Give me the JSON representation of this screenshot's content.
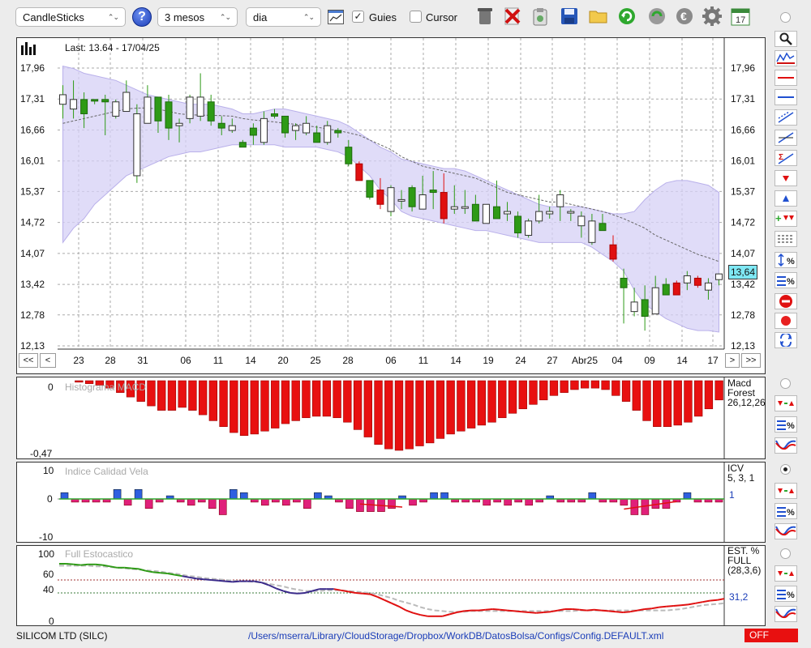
{
  "toolbar": {
    "chart_type": "CandleSticks",
    "period": "3 mesos",
    "interval": "dia",
    "guides_label": "Guies",
    "guides_checked": true,
    "cursor_label": "Cursor",
    "cursor_checked": false,
    "calendar_day": "17"
  },
  "main": {
    "last_label": "Last: 13.64 - 17/04/25",
    "price_badge": "13,64",
    "y_ticks": [
      "17,96",
      "17,31",
      "16,66",
      "16,01",
      "15,37",
      "14,72",
      "14,07",
      "13,42",
      "12,78",
      "12,13"
    ],
    "x_ticks": [
      "23",
      "28",
      "31",
      "06",
      "11",
      "14",
      "20",
      "25",
      "28",
      "06",
      "11",
      "14",
      "19",
      "24",
      "27",
      "Abr25",
      "04",
      "09",
      "14",
      "17"
    ],
    "nav": {
      "first": "<<",
      "prev": "<",
      "next": ">",
      "last": ">>"
    }
  },
  "macd": {
    "title": "Histograma MACD",
    "label_line1": "Macd",
    "label_line2": "Forest",
    "label_line3": "26,12,26",
    "y_top": "0",
    "y_bottom": "-0,47"
  },
  "icv": {
    "title": "Indice Calidad Vela",
    "label_line1": "ICV",
    "label_line2": "5, 3, 1",
    "value": "1",
    "y_top": "10",
    "y_mid": "0",
    "y_bottom": "-10"
  },
  "stoch": {
    "title": "Full Estocastico",
    "label_line1": "EST. %",
    "label_line2": "FULL",
    "label_line3": "(28,3,6)",
    "value": "31,2",
    "y_ticks": [
      "100",
      "60",
      "40",
      "0"
    ]
  },
  "status": {
    "symbol": "SILICOM LTD (SILC)",
    "path": "/Users/mserra/Library/CloudStorage/Dropbox/WorkDB/DatosBolsa/Configs/Config.DEFAULT.xml",
    "off_label": "OFF"
  },
  "colors": {
    "up": "#2e9a16",
    "down": "#e01010",
    "band": "#d6d0f5",
    "badge": "#7fe8f4",
    "macd": "#e81010",
    "icv_pos": "#2f5fe0",
    "icv_neg": "#e0207a"
  },
  "chart_data": [
    {
      "type": "candlestick",
      "title": "",
      "ylim": [
        12.13,
        18.3
      ],
      "candles": [
        {
          "o": 17.2,
          "h": 17.6,
          "l": 16.9,
          "c": 17.4
        },
        {
          "o": 17.1,
          "h": 17.7,
          "l": 16.9,
          "c": 17.3
        },
        {
          "o": 17.3,
          "h": 17.45,
          "l": 16.7,
          "c": 17.0
        },
        {
          "o": 17.3,
          "h": 17.3,
          "l": 17.2,
          "c": 17.28
        },
        {
          "o": 17.3,
          "h": 17.4,
          "l": 16.55,
          "c": 17.25
        },
        {
          "o": 16.95,
          "h": 17.3,
          "l": 16.9,
          "c": 17.25
        },
        {
          "o": 17.05,
          "h": 17.7,
          "l": 17.05,
          "c": 17.45
        },
        {
          "o": 15.7,
          "h": 17.2,
          "l": 15.55,
          "c": 17.0
        },
        {
          "o": 16.8,
          "h": 17.6,
          "l": 16.8,
          "c": 17.35
        },
        {
          "o": 17.35,
          "h": 17.35,
          "l": 16.6,
          "c": 16.85
        },
        {
          "o": 17.25,
          "h": 17.4,
          "l": 16.45,
          "c": 16.7
        },
        {
          "o": 16.75,
          "h": 16.9,
          "l": 16.4,
          "c": 16.8
        },
        {
          "o": 16.9,
          "h": 17.4,
          "l": 16.8,
          "c": 17.35
        },
        {
          "o": 16.95,
          "h": 17.85,
          "l": 16.85,
          "c": 17.35
        },
        {
          "o": 17.25,
          "h": 17.4,
          "l": 16.75,
          "c": 16.85
        },
        {
          "o": 16.8,
          "h": 16.95,
          "l": 16.55,
          "c": 16.7
        },
        {
          "o": 16.65,
          "h": 16.9,
          "l": 16.6,
          "c": 16.75
        },
        {
          "o": 16.4,
          "h": 16.45,
          "l": 16.3,
          "c": 16.3
        },
        {
          "o": 16.7,
          "h": 16.8,
          "l": 16.35,
          "c": 16.55
        },
        {
          "o": 16.4,
          "h": 17.05,
          "l": 16.35,
          "c": 16.9
        },
        {
          "o": 17.0,
          "h": 17.1,
          "l": 16.9,
          "c": 16.95
        },
        {
          "o": 16.95,
          "h": 16.95,
          "l": 16.5,
          "c": 16.6
        },
        {
          "o": 16.65,
          "h": 16.8,
          "l": 16.45,
          "c": 16.75
        },
        {
          "o": 16.6,
          "h": 16.95,
          "l": 16.55,
          "c": 16.8
        },
        {
          "o": 16.6,
          "h": 16.75,
          "l": 16.4,
          "c": 16.4
        },
        {
          "o": 16.4,
          "h": 16.85,
          "l": 16.35,
          "c": 16.75
        },
        {
          "o": 16.65,
          "h": 16.7,
          "l": 16.5,
          "c": 16.6
        },
        {
          "o": 16.3,
          "h": 16.45,
          "l": 15.9,
          "c": 15.95
        },
        {
          "o": 15.95,
          "h": 16.0,
          "l": 15.6,
          "c": 15.6
        },
        {
          "o": 15.6,
          "h": 15.6,
          "l": 15.2,
          "c": 15.25
        },
        {
          "o": 15.4,
          "h": 15.65,
          "l": 15.0,
          "c": 15.1
        },
        {
          "o": 14.95,
          "h": 15.5,
          "l": 14.85,
          "c": 15.45
        },
        {
          "o": 15.2,
          "h": 15.4,
          "l": 15.0,
          "c": 15.2
        },
        {
          "o": 15.45,
          "h": 15.5,
          "l": 14.95,
          "c": 15.05
        },
        {
          "o": 15.0,
          "h": 15.7,
          "l": 15.0,
          "c": 15.3
        },
        {
          "o": 15.4,
          "h": 15.8,
          "l": 15.0,
          "c": 15.35
        },
        {
          "o": 15.35,
          "h": 15.75,
          "l": 14.7,
          "c": 14.8
        },
        {
          "o": 15.0,
          "h": 15.5,
          "l": 14.9,
          "c": 15.05
        },
        {
          "o": 15.05,
          "h": 15.4,
          "l": 14.9,
          "c": 15.05
        },
        {
          "o": 15.1,
          "h": 15.3,
          "l": 14.75,
          "c": 14.75
        },
        {
          "o": 14.7,
          "h": 15.0,
          "l": 14.7,
          "c": 15.1
        },
        {
          "o": 15.05,
          "h": 15.6,
          "l": 14.85,
          "c": 14.8
        },
        {
          "o": 14.9,
          "h": 15.15,
          "l": 14.75,
          "c": 14.95
        },
        {
          "o": 14.85,
          "h": 14.95,
          "l": 14.4,
          "c": 14.5
        },
        {
          "o": 14.45,
          "h": 14.8,
          "l": 14.4,
          "c": 14.75
        },
        {
          "o": 14.75,
          "h": 15.3,
          "l": 14.7,
          "c": 14.95
        },
        {
          "o": 14.9,
          "h": 15.05,
          "l": 14.8,
          "c": 14.95
        },
        {
          "o": 15.05,
          "h": 15.4,
          "l": 14.75,
          "c": 15.3
        },
        {
          "o": 14.95,
          "h": 15.0,
          "l": 14.75,
          "c": 14.95
        },
        {
          "o": 14.65,
          "h": 14.95,
          "l": 14.4,
          "c": 14.85
        },
        {
          "o": 14.3,
          "h": 14.9,
          "l": 14.25,
          "c": 14.75
        },
        {
          "o": 14.7,
          "h": 14.9,
          "l": 14.6,
          "c": 14.55
        },
        {
          "o": 14.25,
          "h": 14.45,
          "l": 13.9,
          "c": 13.95
        },
        {
          "o": 13.55,
          "h": 13.75,
          "l": 12.6,
          "c": 13.35
        },
        {
          "o": 12.85,
          "h": 13.35,
          "l": 12.75,
          "c": 13.05
        },
        {
          "o": 13.1,
          "h": 13.4,
          "l": 12.45,
          "c": 12.75
        },
        {
          "o": 12.8,
          "h": 13.6,
          "l": 12.8,
          "c": 13.35
        },
        {
          "o": 13.42,
          "h": 13.55,
          "l": 13.2,
          "c": 13.2
        },
        {
          "o": 13.45,
          "h": 13.5,
          "l": 13.2,
          "c": 13.2
        },
        {
          "o": 13.45,
          "h": 13.7,
          "l": 13.3,
          "c": 13.6
        },
        {
          "o": 13.55,
          "h": 13.6,
          "l": 13.35,
          "c": 13.4
        },
        {
          "o": 13.3,
          "h": 13.55,
          "l": 13.1,
          "c": 13.45
        },
        {
          "o": 13.52,
          "h": 13.65,
          "l": 13.4,
          "c": 13.64
        }
      ],
      "band_upper": [
        18.0,
        17.95,
        17.85,
        17.8,
        17.75,
        17.7,
        17.6,
        17.5,
        17.4,
        17.35,
        17.3,
        17.25,
        17.2,
        17.2,
        17.2,
        17.15,
        17.1,
        17.0,
        17.0,
        17.05,
        17.1,
        17.1,
        17.05,
        17.0,
        16.95,
        16.9,
        16.85,
        16.75,
        16.6,
        16.45,
        16.3,
        16.2,
        16.05,
        16.0,
        15.95,
        15.9,
        15.85,
        15.85,
        15.8,
        15.7,
        15.6,
        15.5,
        15.4,
        15.3,
        15.2,
        15.1,
        15.05,
        15.05,
        15.05,
        15.05,
        15.0,
        14.95,
        14.9,
        14.9,
        14.95,
        15.2,
        15.4,
        15.55,
        15.6,
        15.6,
        15.55,
        15.5,
        15.35
      ],
      "band_lower": [
        14.3,
        14.6,
        14.8,
        15.1,
        15.3,
        15.5,
        15.7,
        15.8,
        15.9,
        16.0,
        16.1,
        16.15,
        16.2,
        16.2,
        16.25,
        16.3,
        16.35,
        16.35,
        16.35,
        16.35,
        16.35,
        16.3,
        16.3,
        16.3,
        16.3,
        16.25,
        16.2,
        16.1,
        15.9,
        15.7,
        15.4,
        15.2,
        14.95,
        14.85,
        14.8,
        14.75,
        14.7,
        14.65,
        14.6,
        14.55,
        14.55,
        14.5,
        14.45,
        14.4,
        14.35,
        14.3,
        14.3,
        14.3,
        14.3,
        14.3,
        14.2,
        14.05,
        13.9,
        13.7,
        13.3,
        13.0,
        12.85,
        12.7,
        12.6,
        12.5,
        12.45,
        12.45,
        12.42
      ],
      "ma": [
        16.8,
        16.85,
        16.9,
        16.95,
        17.0,
        17.05,
        17.1,
        17.12,
        17.12,
        17.1,
        17.05,
        17.0,
        16.98,
        16.97,
        16.97,
        16.96,
        16.95,
        16.9,
        16.87,
        16.85,
        16.83,
        16.8,
        16.78,
        16.75,
        16.72,
        16.68,
        16.65,
        16.6,
        16.55,
        16.45,
        16.35,
        16.25,
        16.1,
        16.0,
        15.9,
        15.85,
        15.8,
        15.75,
        15.7,
        15.65,
        15.55,
        15.45,
        15.35,
        15.3,
        15.25,
        15.2,
        15.15,
        15.15,
        15.1,
        15.05,
        15.0,
        14.95,
        14.88,
        14.8,
        14.7,
        14.6,
        14.45,
        14.35,
        14.25,
        14.15,
        14.05,
        13.98,
        13.9
      ]
    },
    {
      "type": "bar",
      "title": "Histograma MACD",
      "ylim": [
        -0.47,
        0
      ],
      "values": [
        -0.01,
        -0.02,
        -0.03,
        -0.05,
        -0.08,
        -0.11,
        -0.14,
        -0.17,
        -0.2,
        -0.2,
        -0.18,
        -0.2,
        -0.23,
        -0.27,
        -0.31,
        -0.35,
        -0.37,
        -0.36,
        -0.34,
        -0.32,
        -0.29,
        -0.27,
        -0.25,
        -0.24,
        -0.24,
        -0.25,
        -0.28,
        -0.33,
        -0.38,
        -0.43,
        -0.46,
        -0.47,
        -0.46,
        -0.44,
        -0.42,
        -0.39,
        -0.36,
        -0.34,
        -0.32,
        -0.3,
        -0.28,
        -0.25,
        -0.22,
        -0.19,
        -0.16,
        -0.13,
        -0.1,
        -0.08,
        -0.06,
        -0.05,
        -0.05,
        -0.06,
        -0.1,
        -0.14,
        -0.2,
        -0.27,
        -0.31,
        -0.31,
        -0.3,
        -0.28,
        -0.24,
        -0.19,
        -0.13
      ]
    },
    {
      "type": "bar",
      "title": "Indice Calidad Vela",
      "ylim": [
        -10,
        10
      ],
      "values": [
        2,
        -1,
        -1,
        -1,
        -1,
        3,
        -2,
        3,
        -3,
        -1,
        1,
        -1,
        -2,
        -1,
        -3,
        -5,
        3,
        2,
        -1,
        -2,
        -1,
        -2,
        -1,
        -3,
        2,
        1,
        -1,
        -3,
        -4,
        -4,
        -4,
        -3,
        1,
        -2,
        -1,
        2,
        2,
        -1,
        -1,
        -1,
        -2,
        -1,
        -2,
        -1,
        -2,
        -1,
        1,
        -1,
        -1,
        -1,
        2,
        -1,
        -1,
        -2,
        -5,
        -5,
        -3,
        -3,
        -1,
        2,
        -1,
        -1,
        -1
      ]
    },
    {
      "type": "line",
      "title": "Full Estocastico",
      "ylim": [
        0,
        100
      ],
      "series": [
        {
          "values": [
            85,
            85,
            84,
            83,
            84,
            84,
            83,
            81,
            79,
            79,
            78,
            77,
            74,
            72,
            71,
            70,
            68,
            66,
            64,
            62,
            61,
            60,
            59,
            58,
            57,
            58,
            58,
            58,
            56,
            52,
            47,
            43,
            40,
            39,
            40,
            43,
            46,
            46,
            46,
            44,
            42,
            40,
            39,
            38,
            34,
            29,
            24,
            19,
            13,
            9,
            6,
            4,
            4,
            4,
            7,
            10,
            12,
            13,
            13,
            14,
            15,
            14,
            13,
            12,
            11,
            10,
            9,
            10,
            11,
            13,
            15,
            15,
            14,
            13,
            14,
            13,
            12,
            11,
            10,
            11,
            13,
            15,
            16,
            18,
            19,
            20,
            21,
            22,
            24,
            26,
            28,
            29,
            31
          ]
        },
        {
          "values": [
            82,
            82,
            82,
            82,
            82,
            81,
            81,
            80,
            79,
            78,
            77,
            76,
            75,
            74,
            73,
            71,
            70,
            68,
            66,
            65,
            63,
            62,
            61,
            60,
            59,
            58,
            58,
            57,
            56,
            54,
            52,
            50,
            47,
            45,
            43,
            43,
            43,
            44,
            44,
            44,
            43,
            42,
            41,
            40,
            38,
            35,
            32,
            28,
            25,
            22,
            18,
            15,
            13,
            12,
            11,
            11,
            11,
            12,
            12,
            12,
            12,
            12,
            12,
            12,
            12,
            12,
            12,
            12,
            12,
            12,
            12,
            12,
            13,
            13,
            13,
            13,
            13,
            13,
            13,
            13,
            13,
            13,
            13,
            13,
            13,
            14,
            15,
            17,
            19,
            21,
            22,
            23,
            24
          ]
        }
      ]
    }
  ]
}
